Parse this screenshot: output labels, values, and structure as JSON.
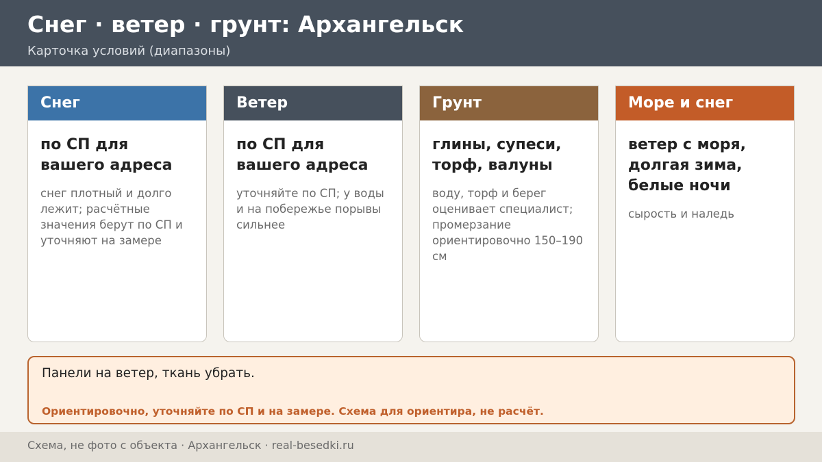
{
  "header": {
    "title": "Снег · ветер · грунт: Архангельск",
    "subtitle": "Карточка условий (диапазоны)"
  },
  "cards": [
    {
      "title": "Снег",
      "color": "#3c73a8",
      "main": "по СП для вашего адреса",
      "note": "снег плотный и долго лежит; расчётные значения берут по СП и уточняют на замере"
    },
    {
      "title": "Ветер",
      "color": "#46505c",
      "main": "по СП для вашего адреса",
      "note": "уточняйте по СП; у воды и на побережье порывы сильнее"
    },
    {
      "title": "Грунт",
      "color": "#8b633d",
      "main": "глины, супеси, торф, валуны",
      "note": "воду, торф и берег оценивает специалист; промерзание ориентировочно 150–190 см"
    },
    {
      "title": "Море и снег",
      "color": "#c35c28",
      "main": "ветер с моря, долгая зима, белые ночи",
      "note": "сырость и наледь"
    }
  ],
  "note_box": {
    "main": "Панели на ветер, ткань убрать.",
    "warning": "Ориентировочно, уточняйте по СП и на замере. Схема для ориентира, не расчёт."
  },
  "footer": {
    "text": "Схема, не фото с объекта  ·  Архангельск  ·  real-besedki.ru"
  }
}
